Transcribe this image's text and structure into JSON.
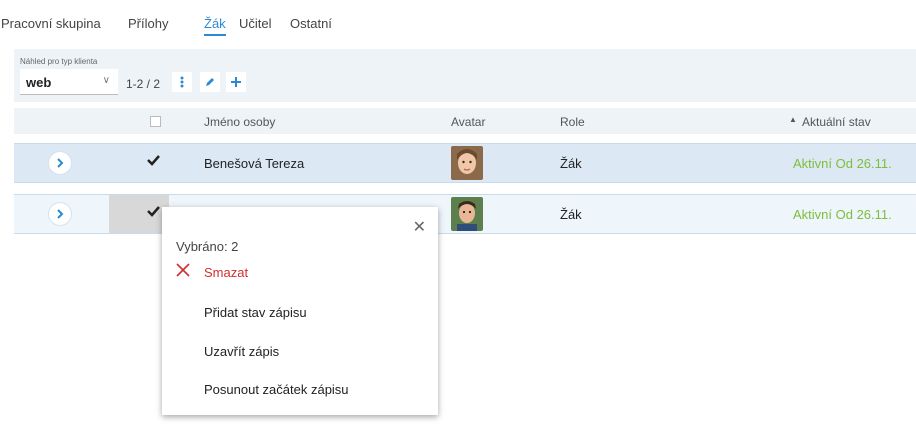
{
  "tabs": [
    {
      "label": "Pracovní skupina"
    },
    {
      "label": "Přílohy"
    },
    {
      "label": "Žák"
    },
    {
      "label": "Učitel"
    },
    {
      "label": "Ostatní"
    }
  ],
  "active_tab": "Žák",
  "toolbar": {
    "client_type_caption": "Náhled pro typ klienta",
    "client_type_value": "web",
    "pager": "1-2 / 2"
  },
  "table": {
    "columns": [
      "Jméno osoby",
      "Avatar",
      "Role",
      "Aktuální stav"
    ],
    "sorted_column": "Aktuální stav",
    "rows": [
      {
        "name": "Benešová Tereza",
        "role": "Žák",
        "status": "Aktivní Od 26.11.",
        "selected": true
      },
      {
        "name": "",
        "role": "Žák",
        "status": "Aktivní Od 26.11.",
        "selected": true
      }
    ]
  },
  "popup": {
    "selected_label": "Vybráno: 2",
    "actions": [
      "Smazat",
      "Přidat stav zápisu",
      "Uzavřít zápis",
      "Posunout začátek zápisu"
    ]
  },
  "colors": {
    "accent": "#2a8ad4",
    "status_green": "#7cbf3b",
    "delete_red": "#d12f2f"
  }
}
